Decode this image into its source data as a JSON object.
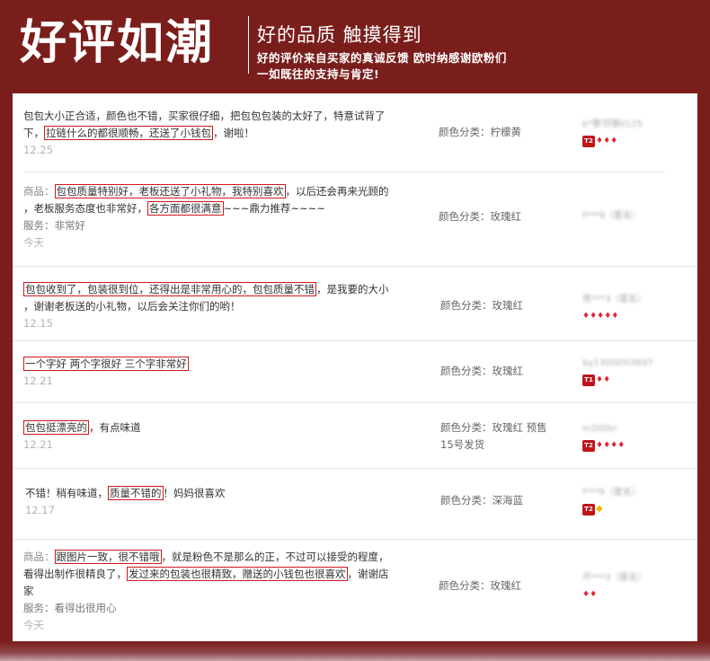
{
  "header": {
    "title": "好评如潮",
    "subtitle": "好的品质 触摸得到",
    "tagline_1": "好的评价来自买家的真诚反馈 欧时纳感谢欧粉们",
    "tagline_2": "一如既往的支持与肯定!"
  },
  "reviews": [
    {
      "c1a": "包包大小正合适，颜色也不错，买家很仔细，把包包包装的太好了，特意试背了",
      "c1b": "下，",
      "hl1": "拉链什么的都很顺畅，还送了小钱包",
      "c1c": "，谢啦！",
      "date": "12.25",
      "spec": "颜色分类：柠檬黄",
      "user": "b*聚邻珊0125",
      "badge": "T2",
      "gems": "♦♦♦"
    },
    {
      "label": "商品：",
      "hl1": "包包质量特别好，老板还送了小礼物，我特别喜欢",
      "c1": "，以后还会再来光顾的",
      "c2": "，老板服务态度也非常好，",
      "hl2": "各方面都很满意",
      "c3": "~~~鼎力推荐~~~~",
      "service": "服务：非常好",
      "date": "今天",
      "spec": "颜色分类：玫瑰红",
      "user": "f***9（匿名）"
    },
    {
      "hl1": "包包收到了，包装很到位，还得出是非常用心的，包包质量不错",
      "c1": "，是我要的大小",
      "c2": "，谢谢老板送的小礼物，以后会关注你们的哟！",
      "date": "12.15",
      "spec": "颜色分类：玫瑰红",
      "user": "夜***3（匿名）",
      "gems": "♦♦♦♦♦"
    },
    {
      "hl1": "一个字好 两个字很好 三个字非常好",
      "date": "12.21",
      "spec": "颜色分类：玫瑰红",
      "user": "by130005l3697",
      "badge": "T1",
      "gems": "♦♦"
    },
    {
      "hl1": "包包挺漂亮的",
      "c1": "，有点味道",
      "date": "12.21",
      "spec": "颜色分类：玫瑰红 预售",
      "spec2": "15号发货",
      "user": "m202kr",
      "badge": "T2",
      "gems": "♦♦♦♦"
    },
    {
      "c1": "不错！稍有味道，",
      "hl1": "质量不错的",
      "c2": "！妈妈很喜欢",
      "date": "12.17",
      "spec": "颜色分类：深海蓝",
      "user": "f***9（匿名）",
      "badge": "T2",
      "gems": "◆"
    },
    {
      "label": "商品：",
      "hl1": "跟图片一致，很不错哦",
      "c1": "，就是粉色不是那么的正，不过可以接受的程度，",
      "c2": "看得出制作很精良了，",
      "hl2": "发过来的包装也很精致，赠送的小钱包也很喜欢",
      "c3": "，谢谢店",
      "c4": "家",
      "service": "服务：看得出很用心",
      "date": "今天",
      "spec": "颜色分类：玫瑰红",
      "user": "开***3（匿名）",
      "gems": "♦♦"
    }
  ]
}
